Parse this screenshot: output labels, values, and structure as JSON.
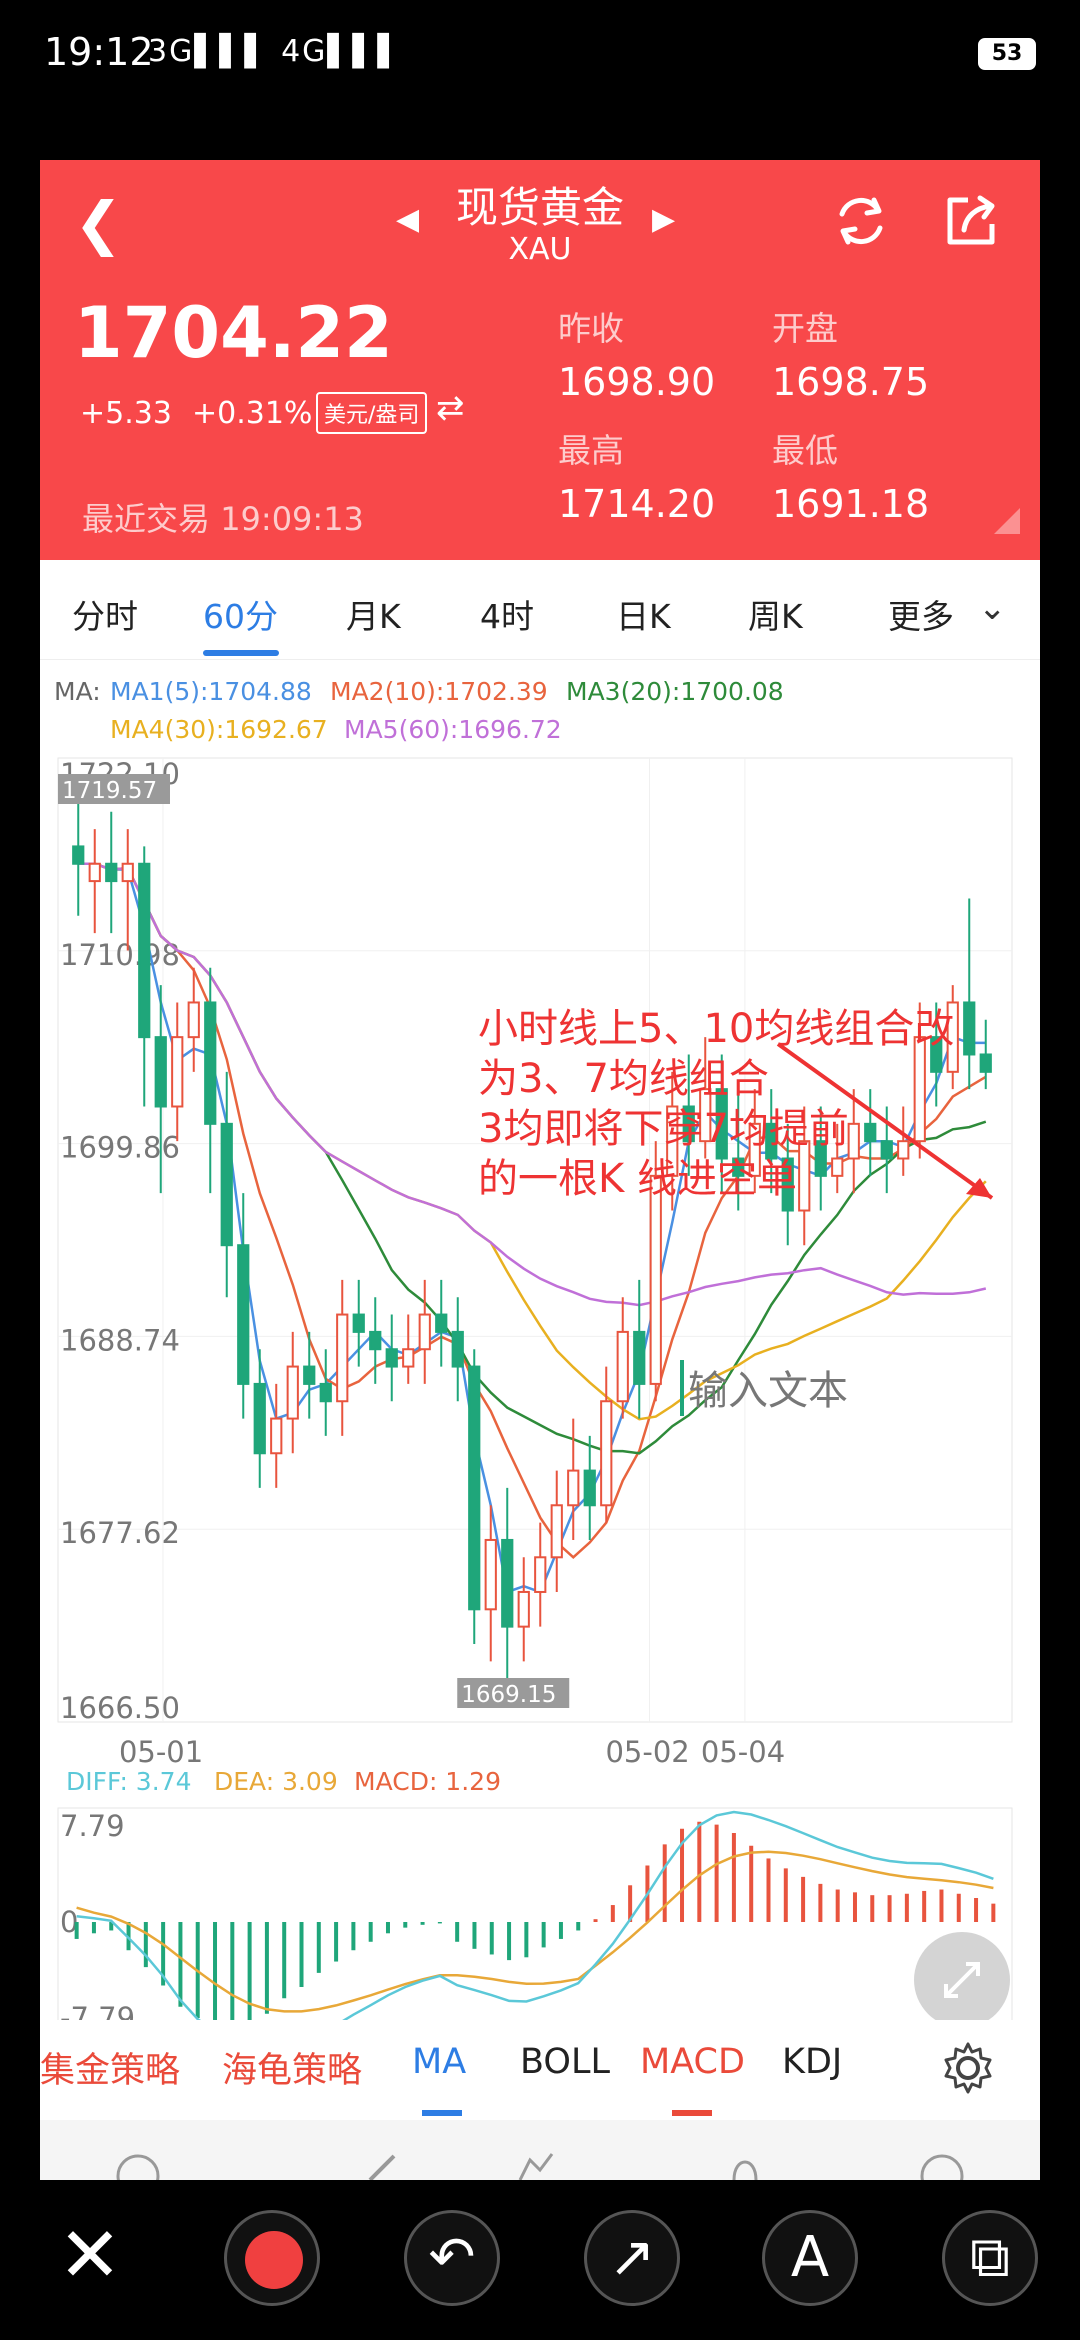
{
  "status_bar": {
    "time": "19:12",
    "network": "3G▌▌▌ 4G▌▌▌",
    "battery": "53"
  },
  "header": {
    "title": "现货黄金",
    "symbol": "XAU",
    "price": "1704.22",
    "change": "+5.33",
    "change_pct": "+0.31%",
    "unit": "美元/盎司",
    "recent_trade_label": "最近交易",
    "recent_trade_time": "19:09:13",
    "prev_close_label": "昨收",
    "prev_close": "1698.90",
    "open_label": "开盘",
    "open": "1698.75",
    "high_label": "最高",
    "high": "1714.20",
    "low_label": "最低",
    "low": "1691.18"
  },
  "tabs": [
    "分时",
    "60分",
    "月K",
    "4时",
    "日K",
    "周K",
    "更多"
  ],
  "active_tab": "60分",
  "ma_legend": {
    "prefix": "MA:",
    "ma1": "MA1(5):1704.88",
    "ma2": "MA2(10):1702.39",
    "ma3": "MA3(20):1700.08",
    "ma4": "MA4(30):1692.67",
    "ma5": "MA5(60):1696.72"
  },
  "macd_legend": {
    "diff": "DIFF: 3.74",
    "dea": "DEA: 3.09",
    "macd": "MACD: 1.29"
  },
  "annotation": {
    "lines": [
      "小时线上5、10均线组合改",
      "为3、7均线组合",
      "3均即将下穿7均提前",
      "的一根K 线进空单"
    ],
    "input_placeholder": "输入文本"
  },
  "indicators": [
    "集金策略",
    "海龟策略",
    "MA",
    "BOLL",
    "MACD",
    "KDJ"
  ],
  "colors": {
    "header_bg": "#f8484a",
    "up": "#e8543e",
    "down": "#1fa67a",
    "ma1": "#4a90e2",
    "ma2": "#e8643e",
    "ma3": "#2e8b3a",
    "ma4": "#e8b020",
    "ma5": "#c070d8",
    "diff": "#5bc8d8",
    "dea": "#e8a838",
    "accent": "#2d7de4"
  },
  "chart_data": [
    {
      "type": "candlestick",
      "title": "",
      "ylim": [
        1666.5,
        1722.1
      ],
      "y_ticks": [
        "1722.10",
        "1710.98",
        "1699.86",
        "1688.74",
        "1677.62",
        "1666.50"
      ],
      "x_ticks": [
        "05-01",
        "05-02",
        "05-04"
      ],
      "max_label": "1719.57",
      "min_label": "1669.15",
      "candles": [
        [
          1717,
          1716,
          1720,
          1713
        ],
        [
          1715,
          1716,
          1718,
          1712
        ],
        [
          1716,
          1715,
          1719,
          1712
        ],
        [
          1715,
          1716,
          1718,
          1711
        ],
        [
          1716,
          1706,
          1717,
          1702
        ],
        [
          1706,
          1702,
          1709,
          1697
        ],
        [
          1702,
          1706,
          1708,
          1700
        ],
        [
          1706,
          1708,
          1710,
          1704
        ],
        [
          1708,
          1701,
          1710,
          1697
        ],
        [
          1701,
          1694,
          1704,
          1691
        ],
        [
          1694,
          1686,
          1697,
          1684
        ],
        [
          1686,
          1682,
          1688,
          1680
        ],
        [
          1682,
          1684,
          1686,
          1680
        ],
        [
          1684,
          1687,
          1689,
          1682
        ],
        [
          1687,
          1686,
          1689,
          1684
        ],
        [
          1686,
          1685,
          1688,
          1683
        ],
        [
          1685,
          1690,
          1692,
          1683
        ],
        [
          1690,
          1689,
          1692,
          1687
        ],
        [
          1689,
          1688,
          1691,
          1686
        ],
        [
          1688,
          1687,
          1690,
          1685
        ],
        [
          1687,
          1688,
          1690,
          1686
        ],
        [
          1688,
          1690,
          1692,
          1686
        ],
        [
          1690,
          1689,
          1692,
          1687
        ],
        [
          1689,
          1687,
          1691,
          1685
        ],
        [
          1687,
          1673,
          1688,
          1671
        ],
        [
          1673,
          1677,
          1679,
          1670
        ],
        [
          1677,
          1672,
          1680,
          1669
        ],
        [
          1672,
          1674,
          1676,
          1670
        ],
        [
          1674,
          1676,
          1678,
          1672
        ],
        [
          1676,
          1679,
          1681,
          1674
        ],
        [
          1679,
          1681,
          1684,
          1677
        ],
        [
          1681,
          1679,
          1683,
          1677
        ],
        [
          1679,
          1685,
          1687,
          1678
        ],
        [
          1685,
          1689,
          1691,
          1684
        ],
        [
          1689,
          1686,
          1692,
          1684
        ],
        [
          1686,
          1698,
          1700,
          1685
        ],
        [
          1698,
          1702,
          1704,
          1696
        ],
        [
          1702,
          1700,
          1705,
          1698
        ],
        [
          1700,
          1703,
          1706,
          1699
        ],
        [
          1703,
          1699,
          1705,
          1697
        ],
        [
          1699,
          1698,
          1703,
          1696
        ],
        [
          1698,
          1701,
          1703,
          1697
        ],
        [
          1701,
          1699,
          1703,
          1697
        ],
        [
          1699,
          1696,
          1701,
          1694
        ],
        [
          1696,
          1700,
          1702,
          1694
        ],
        [
          1700,
          1698,
          1702,
          1696
        ],
        [
          1698,
          1699,
          1701,
          1697
        ],
        [
          1699,
          1701,
          1703,
          1697
        ],
        [
          1701,
          1700,
          1703,
          1698
        ],
        [
          1700,
          1699,
          1702,
          1697
        ],
        [
          1699,
          1700,
          1702,
          1698
        ],
        [
          1700,
          1706,
          1708,
          1699
        ],
        [
          1706,
          1704,
          1708,
          1702
        ],
        [
          1704,
          1708,
          1709,
          1703
        ],
        [
          1708,
          1705,
          1714,
          1703
        ],
        [
          1705,
          1704,
          1707,
          1703
        ]
      ]
    },
    {
      "type": "bar",
      "title": "MACD",
      "ylim": [
        -7.79,
        7.79
      ],
      "y_ticks": [
        "7.79",
        "0",
        "-7.79"
      ],
      "values": [
        -1.2,
        -0.8,
        -0.6,
        -2.0,
        -3.2,
        -4.5,
        -6.0,
        -6.8,
        -7.3,
        -7.6,
        -7.2,
        -6.5,
        -5.4,
        -4.6,
        -3.6,
        -2.8,
        -2.0,
        -1.4,
        -0.8,
        -0.4,
        -0.2,
        -0.1,
        -1.4,
        -1.9,
        -2.3,
        -2.7,
        -2.5,
        -1.8,
        -1.2,
        -0.6,
        0.2,
        1.2,
        2.6,
        4.0,
        5.5,
        6.6,
        7.1,
        6.9,
        6.3,
        5.4,
        4.5,
        3.8,
        3.2,
        2.7,
        2.3,
        2.1,
        1.9,
        1.9,
        2.0,
        2.2,
        2.3,
        2.0,
        1.7,
        1.3
      ]
    }
  ]
}
